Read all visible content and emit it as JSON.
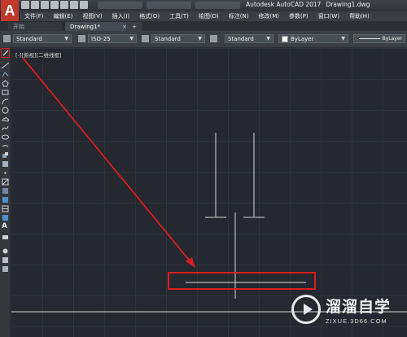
{
  "app": {
    "logo_letter": "A",
    "title": "Autodesk AutoCAD 2017",
    "document": "Drawing1.dwg"
  },
  "menu": [
    "文件(F)",
    "编辑(E)",
    "视图(V)",
    "插入(I)",
    "格式(O)",
    "工具(T)",
    "绘图(D)",
    "标注(N)",
    "修改(M)",
    "参数(P)",
    "窗口(W)",
    "帮助(H)"
  ],
  "tabs": {
    "start": "开始",
    "doc": "Drawing1*",
    "close": "×",
    "add": "+"
  },
  "properties": {
    "text_style": "Standard",
    "dim_style": "ISO-25",
    "table_style": "Standard",
    "multileader_style": "Standard",
    "color": "ByLayer",
    "linetype": "ByLayer"
  },
  "viewport_label": "[-][俯视][二维线框]",
  "watermark": {
    "title": "溜溜自学",
    "url": "ZIXUE.3D66.COM"
  },
  "colors": {
    "annotation_red": "#d81e1e",
    "canvas_bg": "#252830",
    "line": "#d9d9d9"
  }
}
